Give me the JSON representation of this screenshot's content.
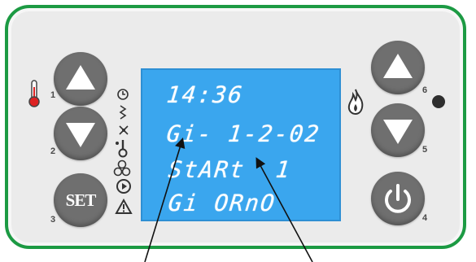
{
  "buttons": {
    "left_up_number": "1",
    "left_down_number": "2",
    "set_label": "SET",
    "set_number": "3",
    "right_up_number": "6",
    "right_down_number": "5",
    "power_number": "4"
  },
  "display": {
    "line1": "14:36",
    "line2": "Gi- 1-2-02",
    "line3": "StARt  1",
    "line4": "Gi ORnO"
  },
  "icons": {
    "left_side": [
      "thermometer-icon"
    ],
    "display_left_column": [
      "clock-icon",
      "heating-icon",
      "fan-icon",
      "ignition-icon",
      "fan-blades-icon",
      "play-icon",
      "warning-icon"
    ],
    "right_side": [
      "flame-icon",
      "status-led"
    ]
  },
  "colors": {
    "frame_green": "#1c9a43",
    "panel_gray": "#ebebeb",
    "button_gray": "#6f6f6f",
    "lcd_blue": "#3aa6ee",
    "lcd_text": "#ffffff"
  }
}
